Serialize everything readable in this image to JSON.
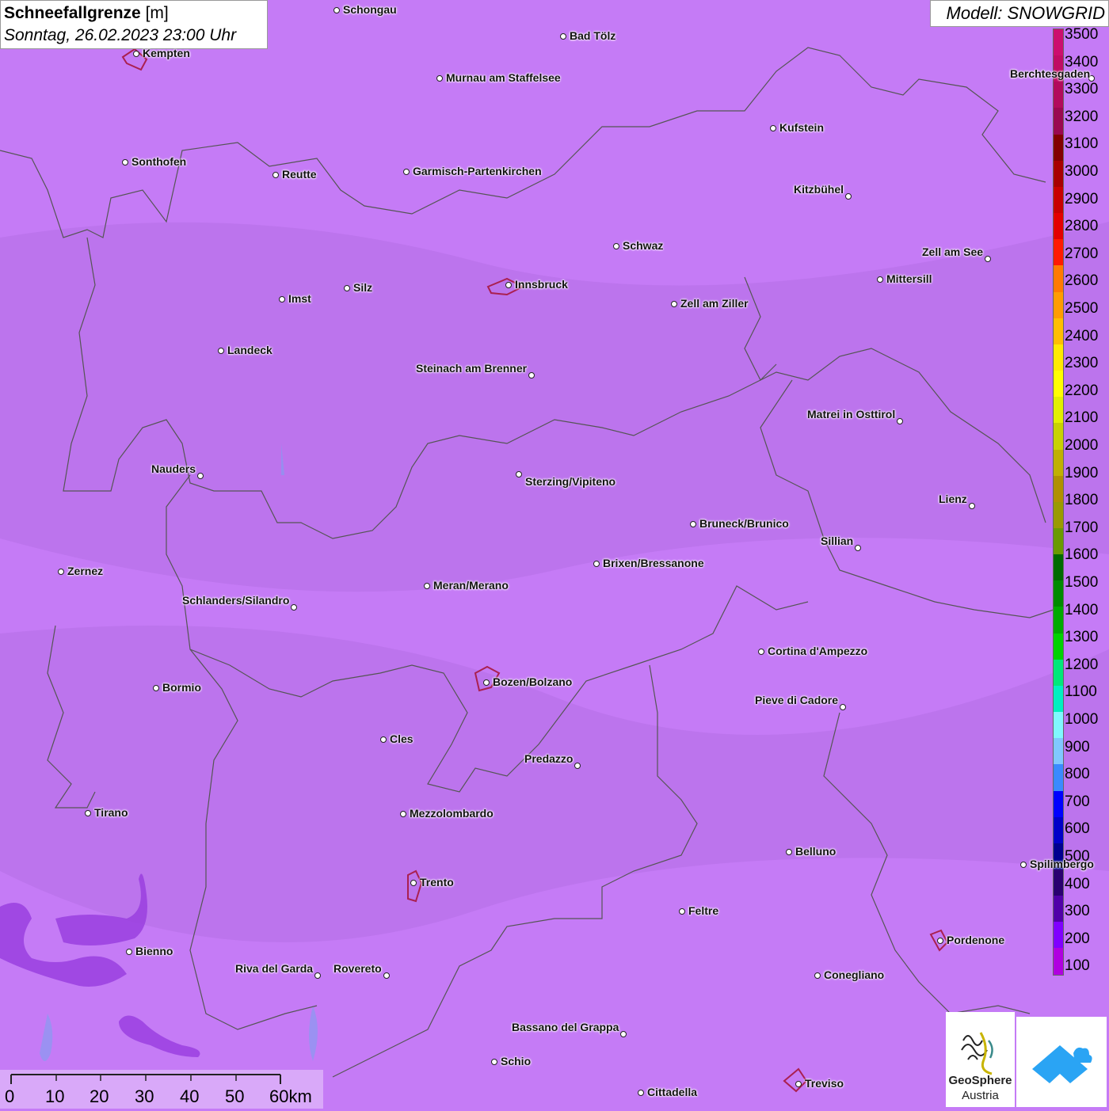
{
  "header": {
    "title_bold": "Schneefallgrenze",
    "title_unit": "[m]",
    "datetime": "Sonntag, 26.02.2023 23:00 Uhr"
  },
  "model": {
    "label": "Modell: SNOWGRID"
  },
  "legend": {
    "labels": [
      "3500",
      "3400",
      "3300",
      "3200",
      "3100",
      "3000",
      "2900",
      "2800",
      "2700",
      "2600",
      "2500",
      "2400",
      "2300",
      "2200",
      "2100",
      "2000",
      "1900",
      "1800",
      "1700",
      "1600",
      "1500",
      "1400",
      "1300",
      "1200",
      "1100",
      "1000",
      "900",
      "800",
      "700",
      "600",
      "500",
      "400",
      "300",
      "200",
      "100"
    ],
    "colors": [
      "#cc0e6e",
      "#c00c64",
      "#b20a5c",
      "#9a0850",
      "#820000",
      "#a80000",
      "#c80000",
      "#e30000",
      "#ff1a00",
      "#ff7a00",
      "#ff9c00",
      "#ffbe00",
      "#ffea00",
      "#ffff00",
      "#e2f000",
      "#c8d200",
      "#c0b000",
      "#b09000",
      "#9a9a00",
      "#6a9a00",
      "#006a00",
      "#008a00",
      "#00aa00",
      "#00d200",
      "#00e87a",
      "#00f0c0",
      "#80f8ff",
      "#80c8ff",
      "#3a8aff",
      "#0000ff",
      "#0000c8",
      "#000090",
      "#2a0070",
      "#5000a8",
      "#8000ff",
      "#b000e0"
    ]
  },
  "cities": [
    {
      "name": "Schongau"
    },
    {
      "name": "Bad Tölz"
    },
    {
      "name": "Kempten"
    },
    {
      "name": "Murnau am Staffelsee"
    },
    {
      "name": "Berchtesgaden"
    },
    {
      "name": "Kufstein"
    },
    {
      "name": "Sonthofen"
    },
    {
      "name": "Reutte"
    },
    {
      "name": "Garmisch-Partenkirchen"
    },
    {
      "name": "Kitzbühel"
    },
    {
      "name": "Schwaz"
    },
    {
      "name": "Zell am See"
    },
    {
      "name": "Innsbruck"
    },
    {
      "name": "Mittersill"
    },
    {
      "name": "Imst"
    },
    {
      "name": "Silz"
    },
    {
      "name": "Zell am Ziller"
    },
    {
      "name": "Landeck"
    },
    {
      "name": "Steinach am Brenner"
    },
    {
      "name": "Matrei in Osttirol"
    },
    {
      "name": "Nauders"
    },
    {
      "name": "Sterzing/Vipiteno"
    },
    {
      "name": "Lienz"
    },
    {
      "name": "Bruneck/Brunico"
    },
    {
      "name": "Sillian"
    },
    {
      "name": "Zernez"
    },
    {
      "name": "Brixen/Bressanone"
    },
    {
      "name": "Meran/Merano"
    },
    {
      "name": "Schlanders/Silandro"
    },
    {
      "name": "Cortina d'Ampezzo"
    },
    {
      "name": "Bozen/Bolzano"
    },
    {
      "name": "Bormio"
    },
    {
      "name": "Pieve di Cadore"
    },
    {
      "name": "Cles"
    },
    {
      "name": "Predazzo"
    },
    {
      "name": "Tirano"
    },
    {
      "name": "Mezzolombardo"
    },
    {
      "name": "Belluno"
    },
    {
      "name": "Spilimbergo"
    },
    {
      "name": "Trento"
    },
    {
      "name": "Feltre"
    },
    {
      "name": "Pordenone"
    },
    {
      "name": "Bienno"
    },
    {
      "name": "Riva del Garda"
    },
    {
      "name": "Rovereto"
    },
    {
      "name": "Conegliano"
    },
    {
      "name": "Bassano del Grappa"
    },
    {
      "name": "Schio"
    },
    {
      "name": "Treviso"
    },
    {
      "name": "Cittadella"
    }
  ],
  "scale": {
    "labels": [
      "0",
      "10",
      "20",
      "30",
      "40",
      "50",
      "60km"
    ]
  },
  "logo": {
    "name_line1": "GeoSphere",
    "name_line2": "Austria"
  }
}
